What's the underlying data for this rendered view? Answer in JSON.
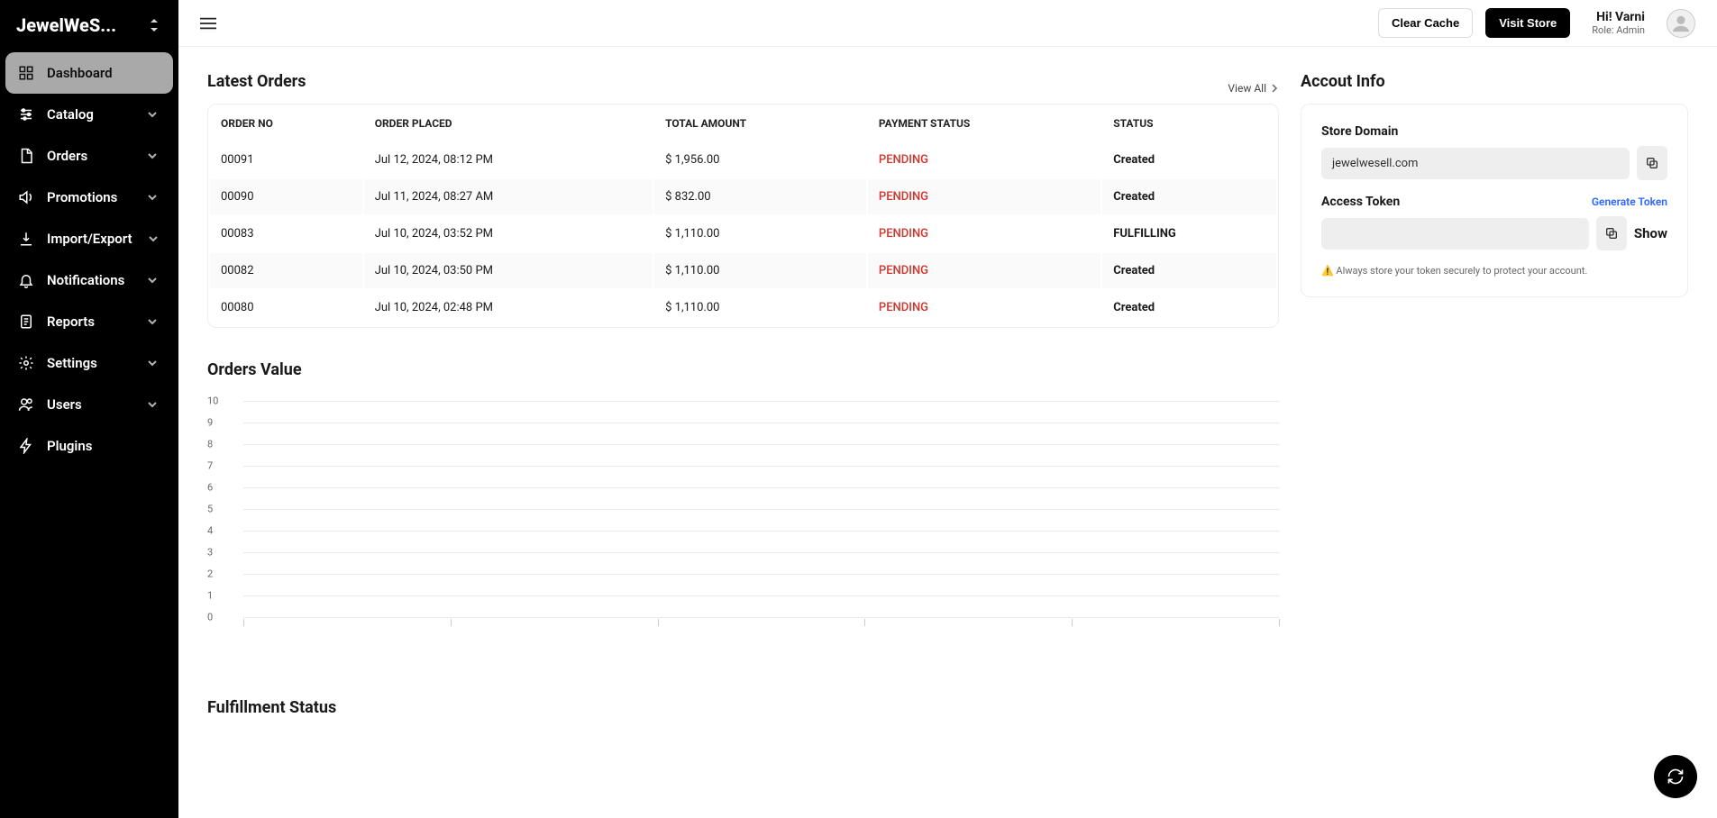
{
  "brand": "JewelWeS...",
  "sidebar": {
    "items": [
      {
        "label": "Dashboard",
        "active": true,
        "icon": "dashboard-icon",
        "expandable": false
      },
      {
        "label": "Catalog",
        "icon": "sliders-icon",
        "expandable": true
      },
      {
        "label": "Orders",
        "icon": "file-icon",
        "expandable": true
      },
      {
        "label": "Promotions",
        "icon": "speaker-icon",
        "expandable": true
      },
      {
        "label": "Import/Export",
        "icon": "download-icon",
        "expandable": true
      },
      {
        "label": "Notifications",
        "icon": "bell-icon",
        "expandable": true
      },
      {
        "label": "Reports",
        "icon": "doc-icon",
        "expandable": true
      },
      {
        "label": "Settings",
        "icon": "gear-icon",
        "expandable": true
      },
      {
        "label": "Users",
        "icon": "users-icon",
        "expandable": true
      },
      {
        "label": "Plugins",
        "icon": "bolt-icon",
        "expandable": false
      }
    ]
  },
  "topbar": {
    "clear_cache": "Clear Cache",
    "visit_store": "Visit Store",
    "hi": "Hi! Varni",
    "role": "Role: Admin"
  },
  "latest_orders": {
    "title": "Latest Orders",
    "view_all": "View All",
    "columns": [
      "ORDER NO",
      "ORDER PLACED",
      "TOTAL AMOUNT",
      "PAYMENT STATUS",
      "STATUS"
    ],
    "rows": [
      {
        "no": "00091",
        "placed": "Jul 12, 2024, 08:12 PM",
        "amount": "$ 1,956.00",
        "payment": "PENDING",
        "status": "Created"
      },
      {
        "no": "00090",
        "placed": "Jul 11, 2024, 08:27 AM",
        "amount": "$ 832.00",
        "payment": "PENDING",
        "status": "Created"
      },
      {
        "no": "00083",
        "placed": "Jul 10, 2024, 03:52 PM",
        "amount": "$ 1,110.00",
        "payment": "PENDING",
        "status": "FULFILLING"
      },
      {
        "no": "00082",
        "placed": "Jul 10, 2024, 03:50 PM",
        "amount": "$ 1,110.00",
        "payment": "PENDING",
        "status": "Created"
      },
      {
        "no": "00080",
        "placed": "Jul 10, 2024, 02:48 PM",
        "amount": "$ 1,110.00",
        "payment": "PENDING",
        "status": "Created"
      }
    ]
  },
  "account": {
    "title": "Accout Info",
    "domain_label": "Store Domain",
    "domain": "jewelwesell.com",
    "token_label": "Access Token",
    "generate": "Generate Token",
    "show": "Show",
    "warn": "⚠️ Always store your token securely to protect your account."
  },
  "orders_value": {
    "title": "Orders Value"
  },
  "fulfillment_title": "Fulfillment Status",
  "chart_data": {
    "type": "bar",
    "title": "Orders Value",
    "xlabel": "",
    "ylabel": "",
    "ylim": [
      0,
      10
    ],
    "y_ticks": [
      0,
      1,
      2,
      3,
      4,
      5,
      6,
      7,
      8,
      9,
      10
    ],
    "x_tick_count": 5,
    "categories": [],
    "values": []
  }
}
